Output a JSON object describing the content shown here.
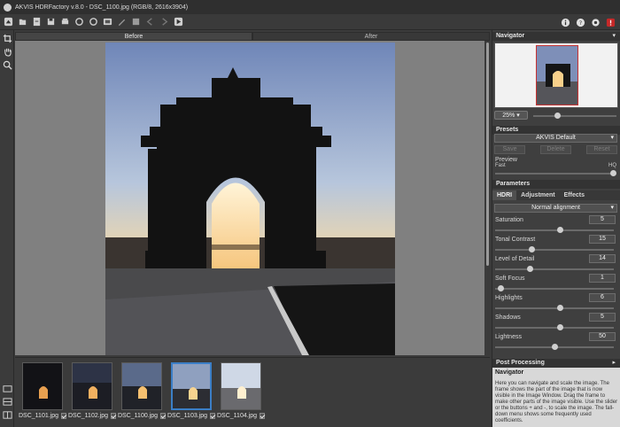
{
  "window": {
    "title": "AKVIS HDRFactory v.8.0 - DSC_1100.jpg (RGB/8, 2616x3904)"
  },
  "view_tabs": [
    {
      "label": "Before"
    },
    {
      "label": "After"
    }
  ],
  "filmstrip": [
    {
      "label": "DSC_1101.jpg",
      "checked": true
    },
    {
      "label": "DSC_1102.jpg",
      "checked": true
    },
    {
      "label": "DSC_1100.jpg",
      "checked": true
    },
    {
      "label": "DSC_1103.jpg",
      "checked": true,
      "selected": true
    },
    {
      "label": "DSC_1104.jpg",
      "checked": true
    }
  ],
  "navigator": {
    "title": "Navigator",
    "zoom": "25%"
  },
  "presets": {
    "title": "Presets",
    "selected": "AKVIS Default",
    "buttons": {
      "save": "Save",
      "delete": "Delete",
      "reset": "Reset"
    },
    "preview": {
      "label": "Preview",
      "fast": "Fast",
      "hq": "HQ"
    }
  },
  "parameters": {
    "title": "Parameters",
    "tabs": {
      "hdri": "HDRI",
      "adjustment": "Adjustment",
      "effects": "Effects"
    },
    "alignment": "Normal alignment",
    "items": [
      {
        "name": "Saturation",
        "value": "5",
        "fraction": 0.55
      },
      {
        "name": "Tonal Contrast",
        "value": "15",
        "fraction": 0.3
      },
      {
        "name": "Level of Detail",
        "value": "14",
        "fraction": 0.28
      },
      {
        "name": "Soft Focus",
        "value": "1",
        "fraction": 0.02
      },
      {
        "name": "Highlights",
        "value": "6",
        "fraction": 0.55
      },
      {
        "name": "Shadows",
        "value": "5",
        "fraction": 0.55
      },
      {
        "name": "Lightness",
        "value": "50",
        "fraction": 0.5
      }
    ]
  },
  "post_processing": {
    "title": "Post Processing"
  },
  "help": {
    "title": "Navigator",
    "text": "Here you can navigate and scale the image. The frame shows the part of the image that is now visible in the Image Window. Drag the frame to make other parts of the image visible. Use the slider or the buttons + and -, to scale the image. The fall-down menu shows some frequently used coefficients."
  },
  "colors": {
    "accent": "#3b7ec6",
    "panel": "#3f3f3f",
    "canvas": "#808080"
  }
}
